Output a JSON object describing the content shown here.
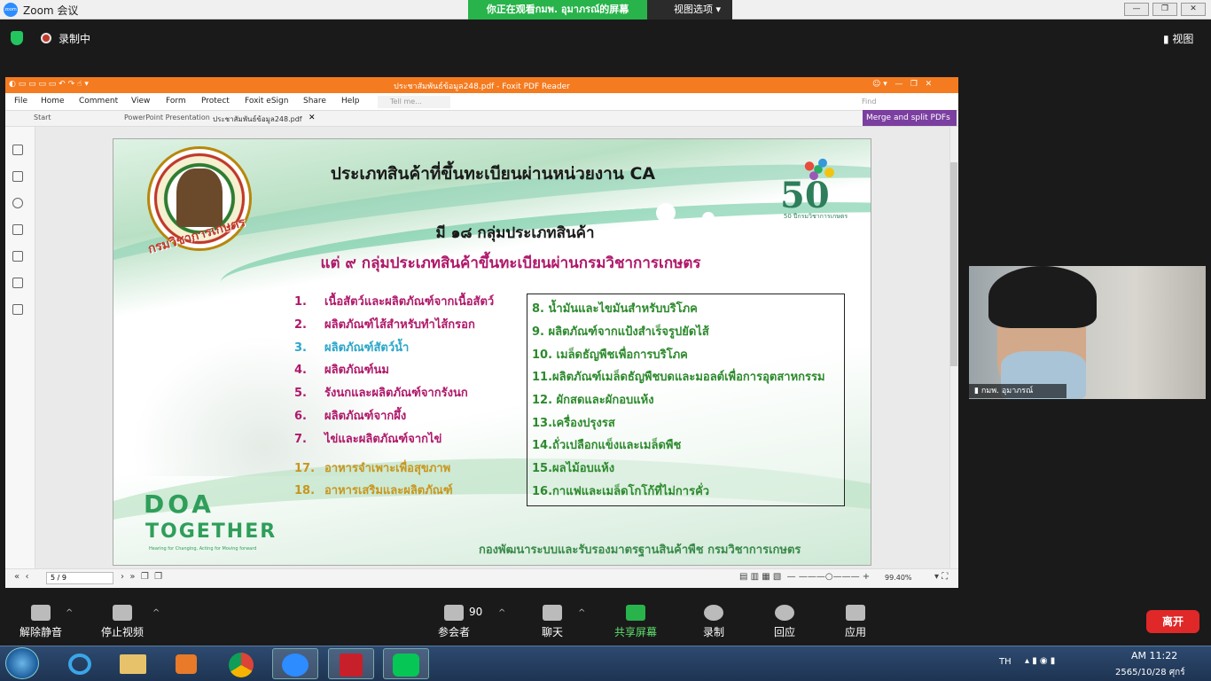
{
  "zoom": {
    "window_title": "Zoom 会议",
    "viewing_banner": "你正在观看กมพ. อุมาภรณ์的屏幕",
    "view_options": "视图选项",
    "recording_label": "录制中",
    "view_button": "视图",
    "toolbar": {
      "unmute": "解除静音",
      "stop_video": "停止视频",
      "participants": "参会者",
      "participants_count": "90",
      "chat": "聊天",
      "share_screen": "共享屏幕",
      "record": "录制",
      "reactions": "回应",
      "apps": "应用",
      "leave": "离开"
    },
    "video_participant_name": "กมพ. อุมาภรณ์"
  },
  "foxit": {
    "title": "ประชาสัมพันธ์ข้อมูล248.pdf - Foxit PDF Reader",
    "menu": [
      "File",
      "Home",
      "Comment",
      "View",
      "Form",
      "Protect",
      "Foxit eSign",
      "Share",
      "Help"
    ],
    "tell_me": "Tell me...",
    "find": "Find",
    "tabs": [
      "Start",
      "PowerPoint Presentation",
      "ประชาสัมพันธ์ข้อมูล248.pdf"
    ],
    "merge_button": "Merge and split PDFs",
    "page_indicator": "5 / 9",
    "zoom_level": "99.40%"
  },
  "slide": {
    "seal_text": "กรมวิชาการเกษตร",
    "logo50_number": "50",
    "logo50_caption": "50 ปีกรมวิชาการเกษตร",
    "title": "ประเภทสินค้าที่ขึ้นทะเบียนผ่านหน่วยงาน CA",
    "subtitle1": "มี ๑๘ กลุ่มประเภทสินค้า",
    "subtitle2": "แต่  ๙  กลุ่มประเภทสินค้าขึ้นทะเบียนผ่านกรมวิชาการเกษตร",
    "left_list": [
      {
        "num": "1.",
        "text": "เนื้อสัตว์และผลิตภัณฑ์จากเนื้อสัตว์",
        "color": "#b0186a"
      },
      {
        "num": "2.",
        "text": "ผลิตภัณฑ์ไส้สำหรับทำไส้กรอก",
        "color": "#b0186a"
      },
      {
        "num": "3.",
        "text": "ผลิตภัณฑ์สัตว์น้ำ",
        "color": "#2aa6c9"
      },
      {
        "num": "4.",
        "text": "ผลิตภัณฑ์นม",
        "color": "#b0186a"
      },
      {
        "num": "5.",
        "text": "รังนกและผลิตภัณฑ์จากรังนก",
        "color": "#b0186a"
      },
      {
        "num": "6.",
        "text": "ผลิตภัณฑ์จากผึ้ง",
        "color": "#b0186a"
      },
      {
        "num": "7.",
        "text": "ไข่และผลิตภัณฑ์จากไข่",
        "color": "#b0186a"
      }
    ],
    "extra_list": [
      {
        "num": "17.",
        "text": "อาหารจำเพาะเพื่อสุขภาพ",
        "color": "#c8961e"
      },
      {
        "num": "18.",
        "text": "อาหารเสริมและผลิตภัณฑ์",
        "color": "#c8961e"
      }
    ],
    "box_list": [
      "8. น้ำมันและไขมันสำหรับบริโภค",
      "9. ผลิตภัณฑ์จากแป้งสำเร็จรูปยัดไส้",
      "10. เมล็ดธัญพืชเพื่อการบริโภค",
      "11.ผลิตภัณฑ์เมล็ดธัญพืชบดและมอลต์เพื่อการอุตสาหกรรม",
      "12. ผักสดและผักอบแห้ง",
      "13.เครื่องปรุงรส",
      "14.ถั่วเปลือกแข็งและเมล็ดพืช",
      "15.ผลไม้อบแห้ง",
      "16.กาแฟและเมล็ดโกโก้ที่ไม่การคั่ว"
    ],
    "doa_logo": "DOA",
    "doa_together": "TOGETHER",
    "doa_tagline": "Hearing for Changing, Acting for Moving forward",
    "footer": "กองพัฒนาระบบและรับรองมาตรฐานสินค้าพืช กรมวิชาการเกษตร"
  },
  "taskbar": {
    "language": "TH",
    "time": "AM 11:22",
    "date": "2565/10/28 ศุกร์"
  }
}
